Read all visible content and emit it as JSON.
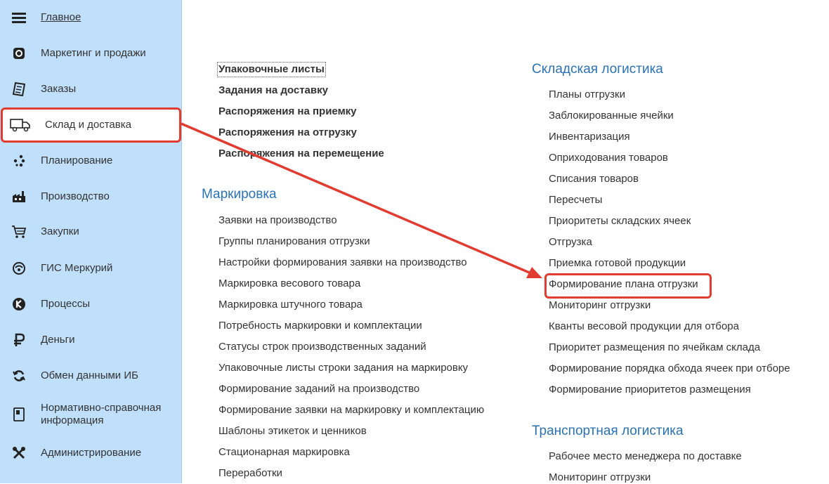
{
  "sidebar": {
    "items": [
      {
        "label": "Главное",
        "icon": "menu-icon"
      },
      {
        "label": "Маркетинг и продажи",
        "icon": "marketing-icon"
      },
      {
        "label": "Заказы",
        "icon": "orders-icon"
      },
      {
        "label": "Склад и доставка",
        "icon": "truck-icon"
      },
      {
        "label": "Планирование",
        "icon": "planning-icon"
      },
      {
        "label": "Производство",
        "icon": "factory-icon"
      },
      {
        "label": "Закупки",
        "icon": "cart-icon"
      },
      {
        "label": "ГИС Меркурий",
        "icon": "mercury-icon"
      },
      {
        "label": "Процессы",
        "icon": "processes-icon"
      },
      {
        "label": "Деньги",
        "icon": "ruble-icon"
      },
      {
        "label": "Обмен данными ИБ",
        "icon": "sync-icon"
      },
      {
        "label": "Нормативно-справочная информация",
        "icon": "book-icon"
      },
      {
        "label": "Администрирование",
        "icon": "tools-icon"
      }
    ]
  },
  "col1": {
    "top_links": [
      "Упаковочные листы",
      "Задания на доставку",
      "Распоряжения на приемку",
      "Распоряжения на отгрузку",
      "Распоряжения на перемещение"
    ],
    "section_title": "Маркировка",
    "links": [
      "Заявки на производство",
      "Группы планирования отгрузки",
      "Настройки формирования заявки на производство",
      "Маркировка весового товара",
      "Маркировка штучного товара",
      "Потребность маркировки и комплектации",
      "Статусы строк производственных заданий",
      "Упаковочные листы строки задания на маркировку",
      "Формирование заданий на производство",
      "Формирование заявки на маркировку и комплектацию",
      "Шаблоны этикеток и ценников",
      "Стационарная маркировка",
      "Переработки"
    ]
  },
  "col2": {
    "section1_title": "Складская логистика",
    "section1_links": [
      "Планы отгрузки",
      "Заблокированные ячейки",
      "Инвентаризация",
      "Оприходования товаров",
      "Списания товаров",
      "Пересчеты",
      "Приоритеты складских ячеек",
      "Отгрузка",
      "Приемка готовой продукции",
      "Формирование плана отгрузки",
      "Мониторинг отгрузки",
      "Кванты весовой продукции для отбора",
      "Приоритет размещения по ячейкам склада",
      "Формирование порядка обхода ячеек при отборе",
      "Формирование приоритетов размещения"
    ],
    "section2_title": "Транспортная логистика",
    "section2_links": [
      "Рабочее место менеджера по доставке",
      "Мониторинг отгрузки"
    ]
  },
  "colors": {
    "sidebar_bg": "#bfdffb",
    "heading": "#2b72b3",
    "annotation_red": "#e03c31"
  }
}
